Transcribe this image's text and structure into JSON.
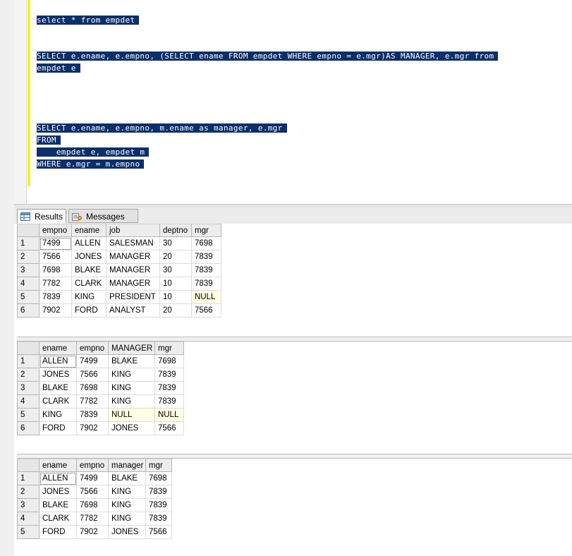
{
  "editor": {
    "lines": [
      {
        "text": "select * from empdet"
      },
      {
        "text": "SELECT e.ename, e.empno, (SELECT ename FROM empdet WHERE empno = e.mgr)AS MANAGER, e.mgr from"
      },
      {
        "text": "empdet e"
      },
      {
        "text": "SELECT e.ename, e.empno, m.ename as manager, e.mgr"
      },
      {
        "text": "FROM"
      },
      {
        "text": "    empdet e, empdet m"
      },
      {
        "text": "WHERE e.mgr = m.empno"
      }
    ]
  },
  "tabs": {
    "results_label": "Results",
    "messages_label": "Messages",
    "results_icon": "grid-icon",
    "messages_icon": "messages-icon"
  },
  "grids": [
    {
      "columns": [
        "empno",
        "ename",
        "job",
        "deptno",
        "mgr"
      ],
      "rows": [
        [
          "1",
          "7499",
          "ALLEN",
          "SALESMAN",
          "30",
          "7698"
        ],
        [
          "2",
          "7566",
          "JONES",
          "MANAGER",
          "20",
          "7839"
        ],
        [
          "3",
          "7698",
          "BLAKE",
          "MANAGER",
          "30",
          "7839"
        ],
        [
          "4",
          "7782",
          "CLARK",
          "MANAGER",
          "10",
          "7839"
        ],
        [
          "5",
          "7839",
          "KING",
          "PRESIDENT",
          "10",
          "NULL"
        ],
        [
          "6",
          "7902",
          "FORD",
          "ANALYST",
          "20",
          "7566"
        ]
      ]
    },
    {
      "columns": [
        "ename",
        "empno",
        "MANAGER",
        "mgr"
      ],
      "rows": [
        [
          "1",
          "ALLEN",
          "7499",
          "BLAKE",
          "7698"
        ],
        [
          "2",
          "JONES",
          "7566",
          "KING",
          "7839"
        ],
        [
          "3",
          "BLAKE",
          "7698",
          "KING",
          "7839"
        ],
        [
          "4",
          "CLARK",
          "7782",
          "KING",
          "7839"
        ],
        [
          "5",
          "KING",
          "7839",
          "NULL",
          "NULL"
        ],
        [
          "6",
          "FORD",
          "7902",
          "JONES",
          "7566"
        ]
      ]
    },
    {
      "columns": [
        "ename",
        "empno",
        "manager",
        "mgr"
      ],
      "rows": [
        [
          "1",
          "ALLEN",
          "7499",
          "BLAKE",
          "7698"
        ],
        [
          "2",
          "JONES",
          "7566",
          "KING",
          "7839"
        ],
        [
          "3",
          "BLAKE",
          "7698",
          "KING",
          "7839"
        ],
        [
          "4",
          "CLARK",
          "7782",
          "KING",
          "7839"
        ],
        [
          "5",
          "FORD",
          "7902",
          "JONES",
          "7566"
        ]
      ]
    }
  ],
  "colors": {
    "selection_bg": "#0b2f6a",
    "selection_fg": "#ffffff",
    "change_bar": "#f0ef35",
    "null_cell_bg": "#ffffe1"
  }
}
